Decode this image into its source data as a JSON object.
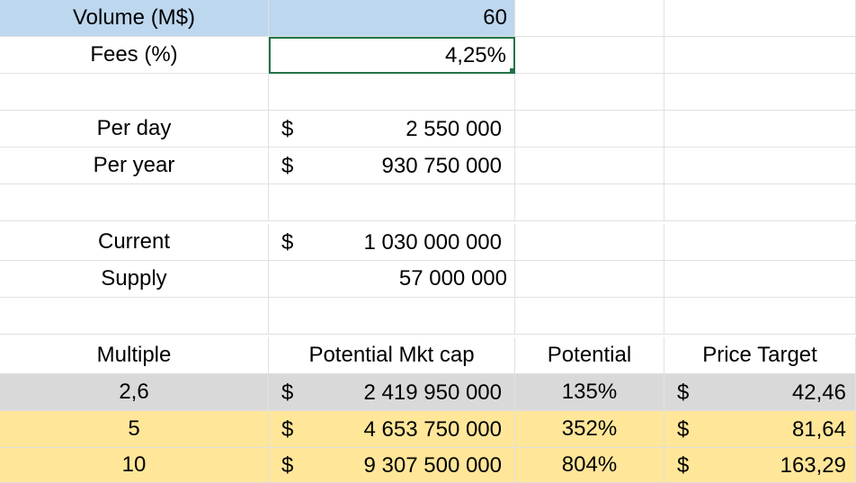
{
  "colors": {
    "header_blue": "#bdd7ee",
    "row_gray": "#d9d9d9",
    "row_yellow": "#ffe699",
    "selection_green": "#217346"
  },
  "volume": {
    "label": "Volume (M$)",
    "value": "60"
  },
  "fees": {
    "label": "Fees (%)",
    "value": "4,25%"
  },
  "per_day": {
    "label": "Per day",
    "currency": "$",
    "value": "2 550 000"
  },
  "per_year": {
    "label": "Per year",
    "currency": "$",
    "value": "930 750 000"
  },
  "current": {
    "label": "Current",
    "currency": "$",
    "value": "1 030 000 000"
  },
  "supply": {
    "label": "Supply",
    "value": "57 000 000"
  },
  "headers": {
    "multiple": "Multiple",
    "mkt_cap": "Potential Mkt cap",
    "potential": "Potential",
    "price_target": "Price Target"
  },
  "rows": [
    {
      "multiple": "2,6",
      "currency": "$",
      "mkt_cap": "2 419 950 000",
      "potential": "135%",
      "price_currency": "$",
      "price": "42,46"
    },
    {
      "multiple": "5",
      "currency": "$",
      "mkt_cap": "4 653 750 000",
      "potential": "352%",
      "price_currency": "$",
      "price": "81,64"
    },
    {
      "multiple": "10",
      "currency": "$",
      "mkt_cap": "9 307 500 000",
      "potential": "804%",
      "price_currency": "$",
      "price": "163,29"
    }
  ]
}
